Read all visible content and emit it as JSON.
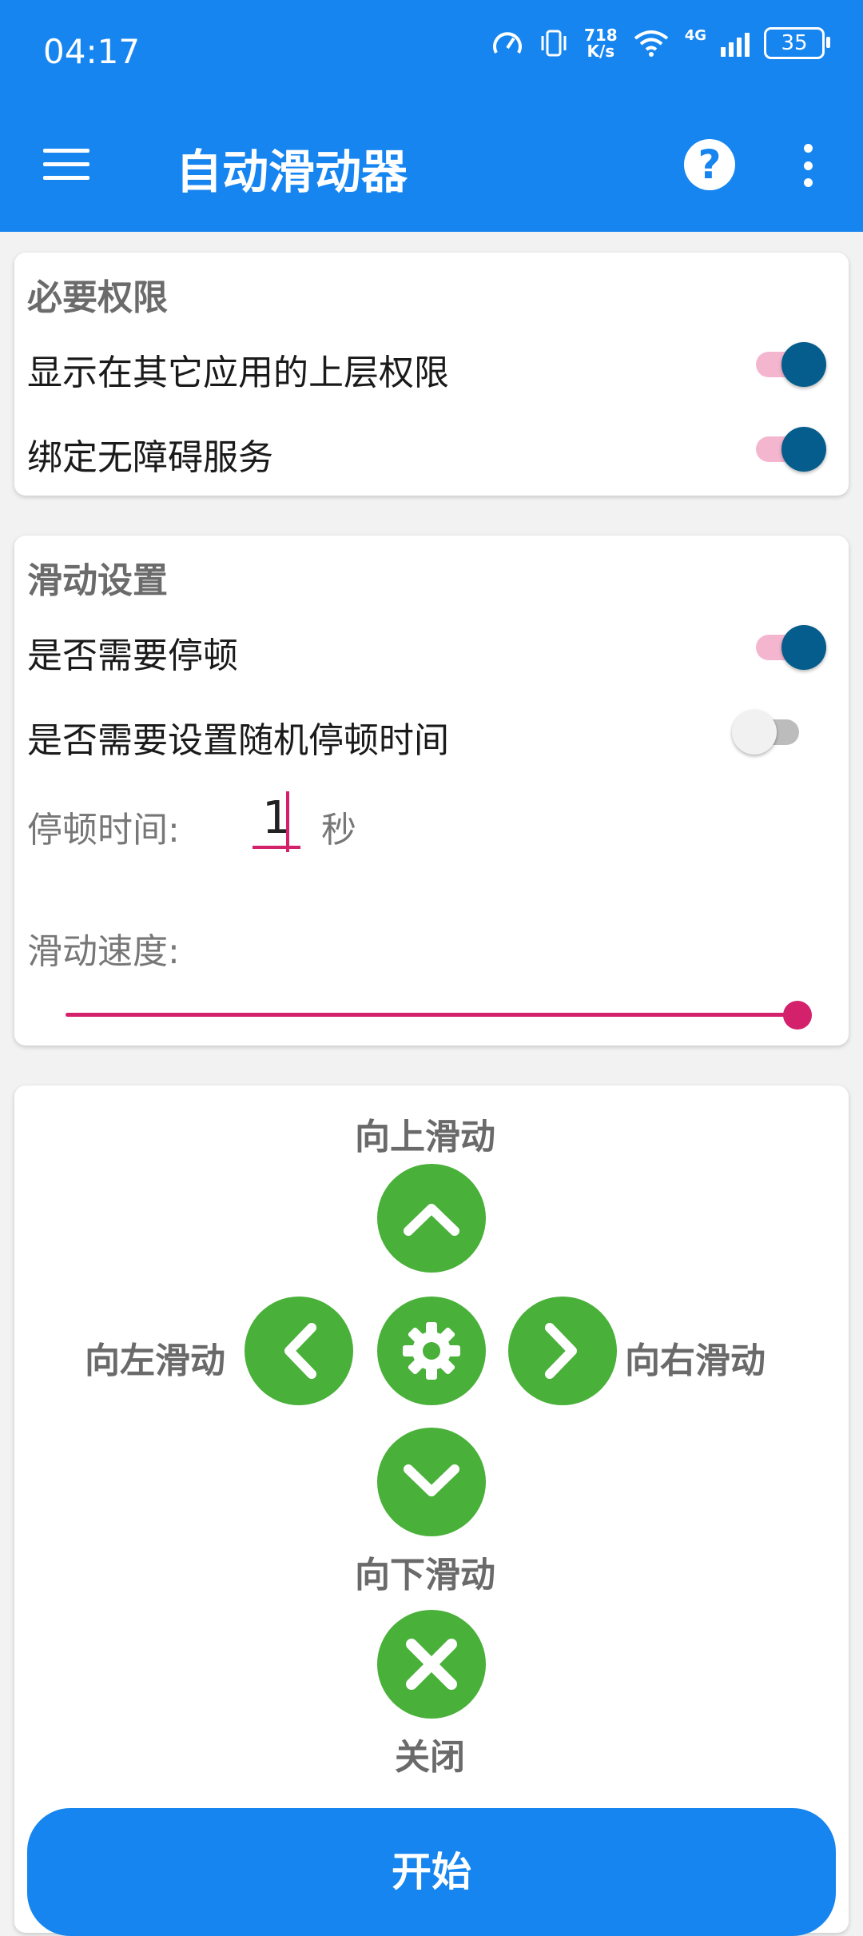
{
  "status_bar": {
    "time": "04:17",
    "net_speed_top": "718",
    "net_speed_bottom": "K/s",
    "network_type": "4G",
    "battery": "35"
  },
  "app_bar": {
    "title": "自动滑动器",
    "menu_icon": "hamburger-menu-icon",
    "help_icon": "question-mark-icon",
    "more_icon": "vertical-dots-icon"
  },
  "permissions": {
    "title": "必要权限",
    "overlay_label": "显示在其它应用的上层权限",
    "overlay_enabled": true,
    "accessibility_label": "绑定无障碍服务",
    "accessibility_enabled": true
  },
  "swipe_settings": {
    "title": "滑动设置",
    "pause_label": "是否需要停顿",
    "pause_enabled": true,
    "random_pause_label": "是否需要设置随机停顿时间",
    "random_pause_enabled": false,
    "pause_time_label": "停顿时间:",
    "pause_time_value": "1",
    "pause_time_unit": "秒",
    "speed_label": "滑动速度:",
    "speed_fraction": 1.0
  },
  "controls": {
    "up_label": "向上滑动",
    "left_label": "向左滑动",
    "right_label": "向右滑动",
    "down_label": "向下滑动",
    "close_label": "关闭"
  },
  "start_button": "开始",
  "colors": {
    "primary": "#1685f0",
    "accent": "#d3216b",
    "switch_thumb_on": "#045d8c",
    "action_green": "#49b039"
  }
}
